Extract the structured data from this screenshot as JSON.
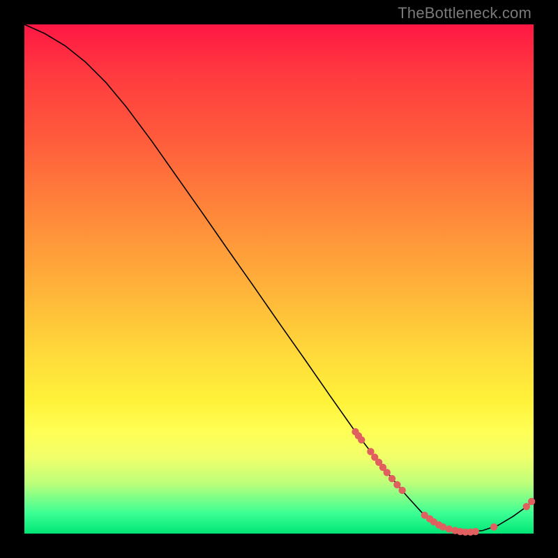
{
  "watermark": "TheBottleneck.com",
  "colors": {
    "marker": "#e06060",
    "curve": "#000000",
    "background_black": "#000000"
  },
  "chart_data": {
    "type": "line",
    "title": "",
    "xlabel": "",
    "ylabel": "",
    "xlim": [
      0,
      100
    ],
    "ylim": [
      0,
      100
    ],
    "legend": false,
    "grid": false,
    "curve": [
      {
        "x": 0,
        "y": 100
      },
      {
        "x": 4,
        "y": 98.2
      },
      {
        "x": 8,
        "y": 95.8
      },
      {
        "x": 12,
        "y": 92.6
      },
      {
        "x": 16,
        "y": 88.6
      },
      {
        "x": 20,
        "y": 83.8
      },
      {
        "x": 25,
        "y": 77.1
      },
      {
        "x": 30,
        "y": 70.0
      },
      {
        "x": 35,
        "y": 62.9
      },
      {
        "x": 40,
        "y": 55.7
      },
      {
        "x": 45,
        "y": 48.6
      },
      {
        "x": 50,
        "y": 41.4
      },
      {
        "x": 55,
        "y": 34.3
      },
      {
        "x": 60,
        "y": 27.1
      },
      {
        "x": 65,
        "y": 20.0
      },
      {
        "x": 70,
        "y": 13.5
      },
      {
        "x": 75,
        "y": 7.5
      },
      {
        "x": 78,
        "y": 4.2
      },
      {
        "x": 81,
        "y": 2.0
      },
      {
        "x": 84,
        "y": 0.7
      },
      {
        "x": 87,
        "y": 0.3
      },
      {
        "x": 90,
        "y": 0.6
      },
      {
        "x": 93,
        "y": 1.6
      },
      {
        "x": 96,
        "y": 3.4
      },
      {
        "x": 98.5,
        "y": 5.2
      },
      {
        "x": 100,
        "y": 6.6
      }
    ],
    "markers": [
      {
        "x": 65.0,
        "y": 20.0
      },
      {
        "x": 65.6,
        "y": 19.2
      },
      {
        "x": 66.2,
        "y": 18.4
      },
      {
        "x": 68.0,
        "y": 16.1
      },
      {
        "x": 68.8,
        "y": 15.0
      },
      {
        "x": 69.6,
        "y": 14.0
      },
      {
        "x": 70.4,
        "y": 13.0
      },
      {
        "x": 71.2,
        "y": 12.0
      },
      {
        "x": 72.2,
        "y": 10.8
      },
      {
        "x": 73.2,
        "y": 9.6
      },
      {
        "x": 74.2,
        "y": 8.5
      },
      {
        "x": 78.6,
        "y": 3.6
      },
      {
        "x": 79.6,
        "y": 2.9
      },
      {
        "x": 80.4,
        "y": 2.3
      },
      {
        "x": 81.4,
        "y": 1.7
      },
      {
        "x": 82.2,
        "y": 1.3
      },
      {
        "x": 83.4,
        "y": 0.9
      },
      {
        "x": 84.6,
        "y": 0.6
      },
      {
        "x": 85.6,
        "y": 0.4
      },
      {
        "x": 86.6,
        "y": 0.3
      },
      {
        "x": 87.6,
        "y": 0.3
      },
      {
        "x": 88.6,
        "y": 0.4
      },
      {
        "x": 92.2,
        "y": 1.3
      },
      {
        "x": 98.6,
        "y": 5.3
      },
      {
        "x": 99.6,
        "y": 6.3
      }
    ]
  }
}
